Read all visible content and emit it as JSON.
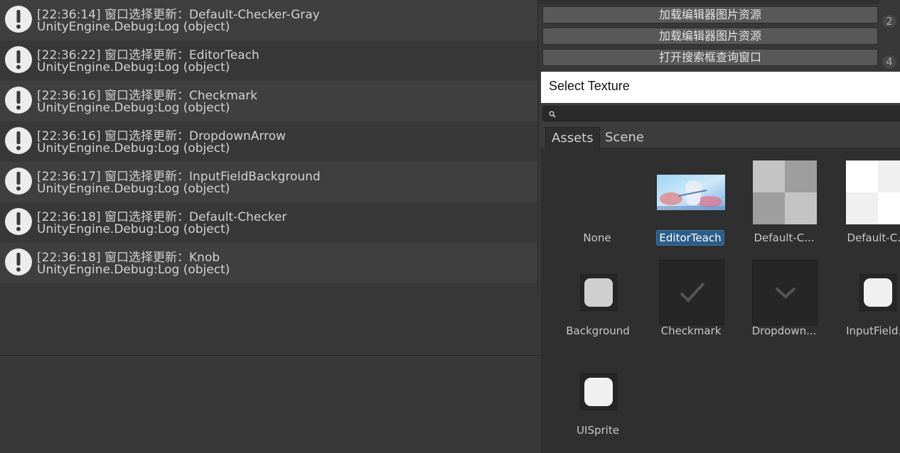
{
  "console": {
    "entries": [
      {
        "line1": "[22:36:14] 窗口选择更新：Default-Checker-Gray",
        "line2": "UnityEngine.Debug:Log (object)"
      },
      {
        "line1": "[22:36:22] 窗口选择更新：EditorTeach",
        "line2": "UnityEngine.Debug:Log (object)"
      },
      {
        "line1": "[22:36:16] 窗口选择更新：Checkmark",
        "line2": "UnityEngine.Debug:Log (object)"
      },
      {
        "line1": "[22:36:16] 窗口选择更新：DropdownArrow",
        "line2": "UnityEngine.Debug:Log (object)"
      },
      {
        "line1": "[22:36:17] 窗口选择更新：InputFieldBackground",
        "line2": "UnityEngine.Debug:Log (object)"
      },
      {
        "line1": "[22:36:18] 窗口选择更新：Default-Checker",
        "line2": "UnityEngine.Debug:Log (object)"
      },
      {
        "line1": "[22:36:18] 窗口选择更新：Knob",
        "line2": "UnityEngine.Debug:Log (object)"
      }
    ],
    "icon": "warning-exclamation-icon"
  },
  "inspector": {
    "buttons": [
      {
        "label": "加载编辑器图片资源",
        "badge": "2"
      },
      {
        "label": "加载编辑器图片资源",
        "badge": ""
      },
      {
        "label": "打开搜索框查询窗口",
        "badge": "4"
      }
    ]
  },
  "picker": {
    "title": "Select Texture",
    "search_value": "",
    "tabs": [
      {
        "label": "Assets",
        "active": true
      },
      {
        "label": "Scene",
        "active": false
      }
    ],
    "items": [
      {
        "label": "None",
        "selected": false
      },
      {
        "label": "EditorTeach",
        "selected": true
      },
      {
        "label": "Default-C...",
        "selected": false
      },
      {
        "label": "Default-C...",
        "selected": false
      },
      {
        "label": "Background",
        "selected": false
      },
      {
        "label": "Checkmark",
        "selected": false
      },
      {
        "label": "Dropdown...",
        "selected": false
      },
      {
        "label": "InputField...",
        "selected": false
      },
      {
        "label": "UISprite",
        "selected": false
      }
    ],
    "selection_color": "#2c5d87"
  }
}
